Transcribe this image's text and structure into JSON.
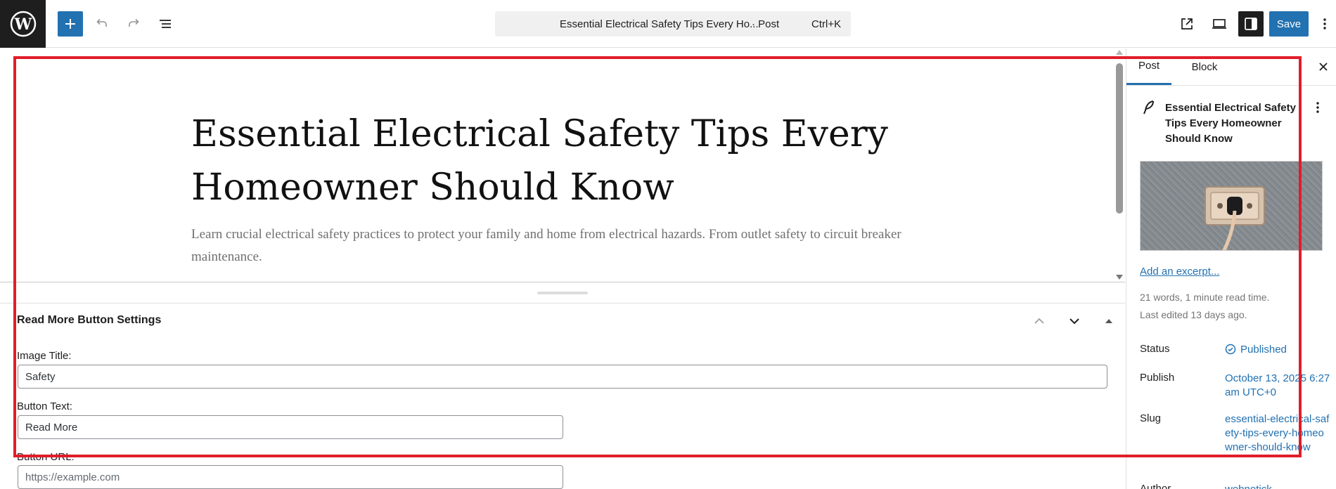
{
  "topbar": {
    "command_title": "Essential Electrical Safety Tips Every Ho...",
    "command_type": "· Post",
    "command_shortcut": "Ctrl+K",
    "save_label": "Save"
  },
  "post": {
    "title": "Essential Electrical Safety Tips Every Homeowner Should Know",
    "excerpt": "Learn crucial electrical safety practices to protect your family and home from electrical hazards. From outlet safety to circuit breaker maintenance."
  },
  "metabox": {
    "title": "Read More Button Settings",
    "image_title_label": "Image Title:",
    "image_title_value": "Safety",
    "button_text_label": "Button Text:",
    "button_text_value": "Read More",
    "button_url_label": "Button URL:",
    "button_url_placeholder": "https://example.com"
  },
  "sidebar": {
    "tabs": [
      {
        "label": "Post"
      },
      {
        "label": "Block"
      }
    ],
    "summary_title": "Essential Electrical Safety Tips Every Homeowner Should Know",
    "excerpt_link": "Add an excerpt...",
    "stats": "21 words, 1 minute read time.",
    "last_edited": "Last edited 13 days ago.",
    "status_label": "Status",
    "status_value": "Published",
    "publish_label": "Publish",
    "publish_value": "October 13, 2025 6:27 am UTC+0",
    "slug_label": "Slug",
    "slug_value": "essential-electrical-safety-tips-every-homeowner-should-know",
    "author_label": "Author",
    "author_value": "webnotick"
  },
  "colors": {
    "accent": "#2271b1",
    "highlight": "#e11d2a",
    "dark": "#1e1e1e"
  },
  "icons": [
    "wordpress-logo",
    "plus-icon",
    "undo-icon",
    "redo-icon",
    "document-overview-icon",
    "external-view-icon",
    "desktop-preview-icon",
    "sidebar-settings-icon",
    "more-vertical-icon",
    "close-icon",
    "feather-icon",
    "chevron-up-icon",
    "chevron-down-icon",
    "triangle-up-icon",
    "check-circle-icon"
  ]
}
